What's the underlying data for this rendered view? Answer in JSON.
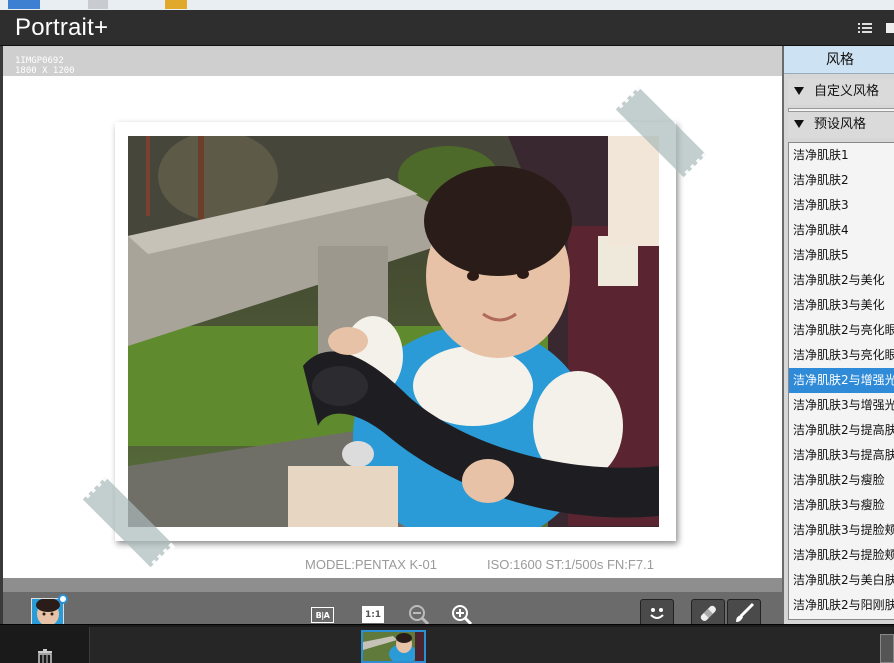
{
  "app": {
    "title": "Portrait+"
  },
  "file": {
    "name": "1IMGP0692",
    "dimensions": "1800 X 1200"
  },
  "exif": {
    "model": "MODEL:PENTAX K-01",
    "settings": "ISO:1600  ST:1/500s FN:F7.1"
  },
  "toolbar": {
    "before_after_label": "B|A",
    "actual_size_label": "1:1",
    "icons": [
      "zoom-out-icon",
      "zoom-in-icon",
      "smile-icon",
      "bandage-icon",
      "brush-icon"
    ]
  },
  "panel": {
    "title": "风格",
    "custom_section": "自定义风格",
    "preset_section": "预设风格",
    "selected_index": 9,
    "styles": [
      "洁净肌肤1",
      "洁净肌肤2",
      "洁净肌肤3",
      "洁净肌肤4",
      "洁净肌肤5",
      "洁净肌肤2与美化",
      "洁净肌肤3与美化",
      "洁净肌肤2与亮化眼",
      "洁净肌肤3与亮化眼",
      "洁净肌肤2与增强光",
      "洁净肌肤3与增强光",
      "洁净肌肤2与提高肤",
      "洁净肌肤3与提高肤",
      "洁净肌肤2与瘦脸",
      "洁净肌肤3与瘦脸",
      "洁净肌肤3与提脸颊",
      "洁净肌肤2与提脸颊",
      "洁净肌肤2与美白肤",
      "洁净肌肤2与阳刚肤"
    ]
  },
  "colors": {
    "accent": "#2f8ad8",
    "titlebar": "#2e2e2e",
    "panel_header": "#cde2f3"
  }
}
